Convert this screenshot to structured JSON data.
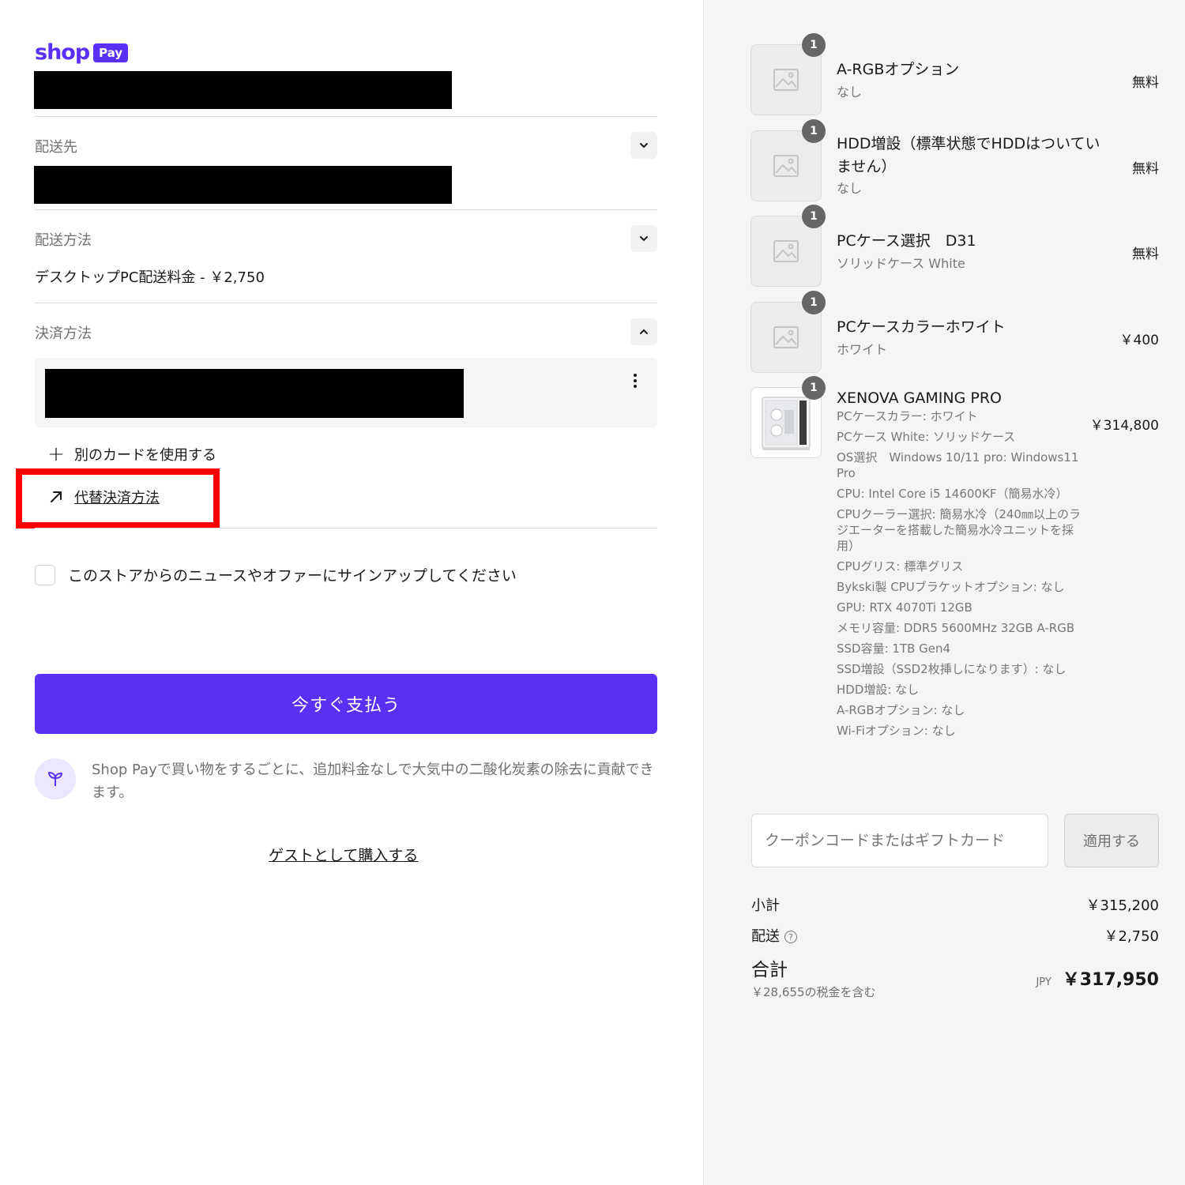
{
  "logo": {
    "shop": "shop",
    "pay": "Pay"
  },
  "shipping_to": {
    "label": "配送先"
  },
  "shipping_method": {
    "label": "配送方法",
    "value": "デスクトップPC配送料金 - ￥2,750"
  },
  "payment": {
    "label": "決済方法",
    "add_card": "別のカードを使用する",
    "alt_payment": "代替決済方法"
  },
  "newsletter": {
    "label": "このストアからのニュースやオファーにサインアップしてください"
  },
  "pay_button": {
    "label": "今すぐ支払う"
  },
  "eco": {
    "text": "Shop Payで買い物をするごとに、追加料金なしで大気中の二酸化炭素の除去に貢献できます。"
  },
  "guest": {
    "label": "ゲストとして購入する"
  },
  "items": [
    {
      "qty": "1",
      "title": "A-RGBオプション",
      "sub": "なし",
      "price": "無料"
    },
    {
      "qty": "1",
      "title": "HDD増設（標準状態でHDDはついていません）",
      "sub": "なし",
      "price": "無料"
    },
    {
      "qty": "1",
      "title": "PCケース選択　D31",
      "sub": "ソリッドケース White",
      "price": "無料"
    },
    {
      "qty": "1",
      "title": "PCケースカラーホワイト",
      "sub": "ホワイト",
      "price": "￥400"
    },
    {
      "qty": "1",
      "title": "XENOVA GAMING PRO",
      "price": "￥314,800",
      "properties": [
        "PCケースカラー: ホワイト",
        "PCケース White: ソリッドケース",
        "OS選択　Windows 10/11 pro: Windows11 Pro",
        "CPU: Intel Core i5 14600KF（簡易水冷）",
        "CPUクーラー選択: 簡易水冷（240㎜以上のラジエーターを搭載した簡易水冷ユニットを採用）",
        "CPUグリス: 標準グリス",
        "Bykski製 CPUブラケットオプション: なし",
        "GPU: RTX 4070Ti 12GB",
        "メモリ容量: DDR5 5600MHz 32GB A-RGB",
        "SSD容量: 1TB Gen4",
        "SSD増設（SSD2枚挿しになります）: なし",
        "HDD増設: なし",
        "A-RGBオプション: なし",
        "Wi-Fiオプション: なし"
      ]
    }
  ],
  "coupon": {
    "placeholder": "クーポンコードまたはギフトカード",
    "apply": "適用する"
  },
  "summary": {
    "subtotal_label": "小計",
    "subtotal": "￥315,200",
    "shipping_label": "配送",
    "shipping_help": "?",
    "shipping": "￥2,750",
    "total_label": "合計",
    "currency": "JPY",
    "total": "￥317,950",
    "tax_note": "￥28,655の税金を含む"
  },
  "colors": {
    "accent": "#5a31f4",
    "highlight": "#ff0000",
    "redaction": "#000000"
  }
}
